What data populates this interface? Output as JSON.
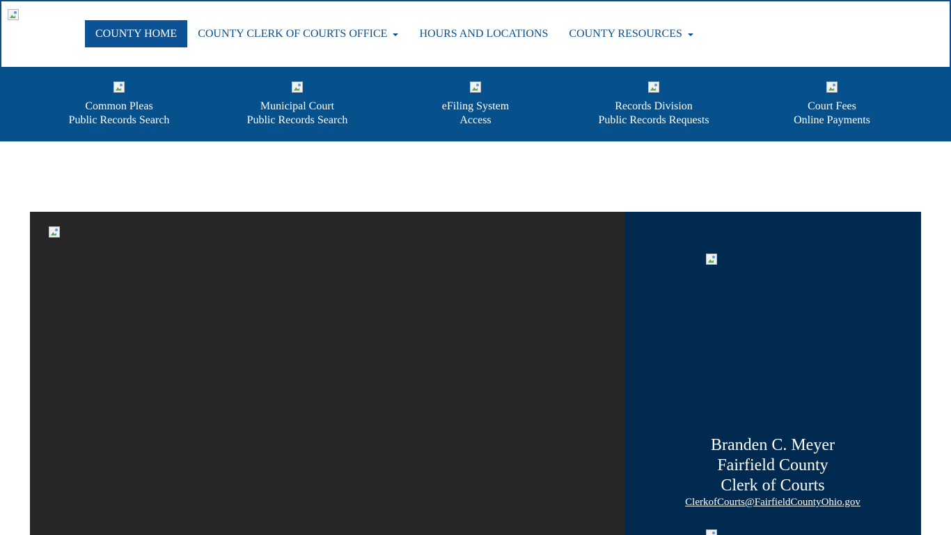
{
  "header": {
    "logo_icon": "county-seal-image",
    "nav": [
      {
        "label": "COUNTY HOME",
        "active": true,
        "dropdown": false
      },
      {
        "label": "COUNTY CLERK OF COURTS OFFICE",
        "active": false,
        "dropdown": true
      },
      {
        "label": "HOURS AND LOCATIONS",
        "active": false,
        "dropdown": false
      },
      {
        "label": "COUNTY RESOURCES",
        "active": false,
        "dropdown": true
      }
    ]
  },
  "quicklinks": [
    {
      "line1": "Common Pleas",
      "line2": "Public Records Search"
    },
    {
      "line1": "Municipal Court",
      "line2": "Public Records Search"
    },
    {
      "line1": "eFiling System",
      "line2": "Access"
    },
    {
      "line1": "Records Division",
      "line2": "Public Records Requests"
    },
    {
      "line1": "Court Fees",
      "line2": "Online Payments"
    }
  ],
  "clerk": {
    "name": "Branden C. Meyer",
    "county": "Fairfield County",
    "title": "Clerk of Courts",
    "email": "ClerkofCourts@FairfieldCountyOhio.gov"
  },
  "colors": {
    "brand_blue": "#0b5394",
    "quickbar_blue": "#06508c",
    "panel_dark": "#262626",
    "panel_navy": "#002a4f"
  }
}
